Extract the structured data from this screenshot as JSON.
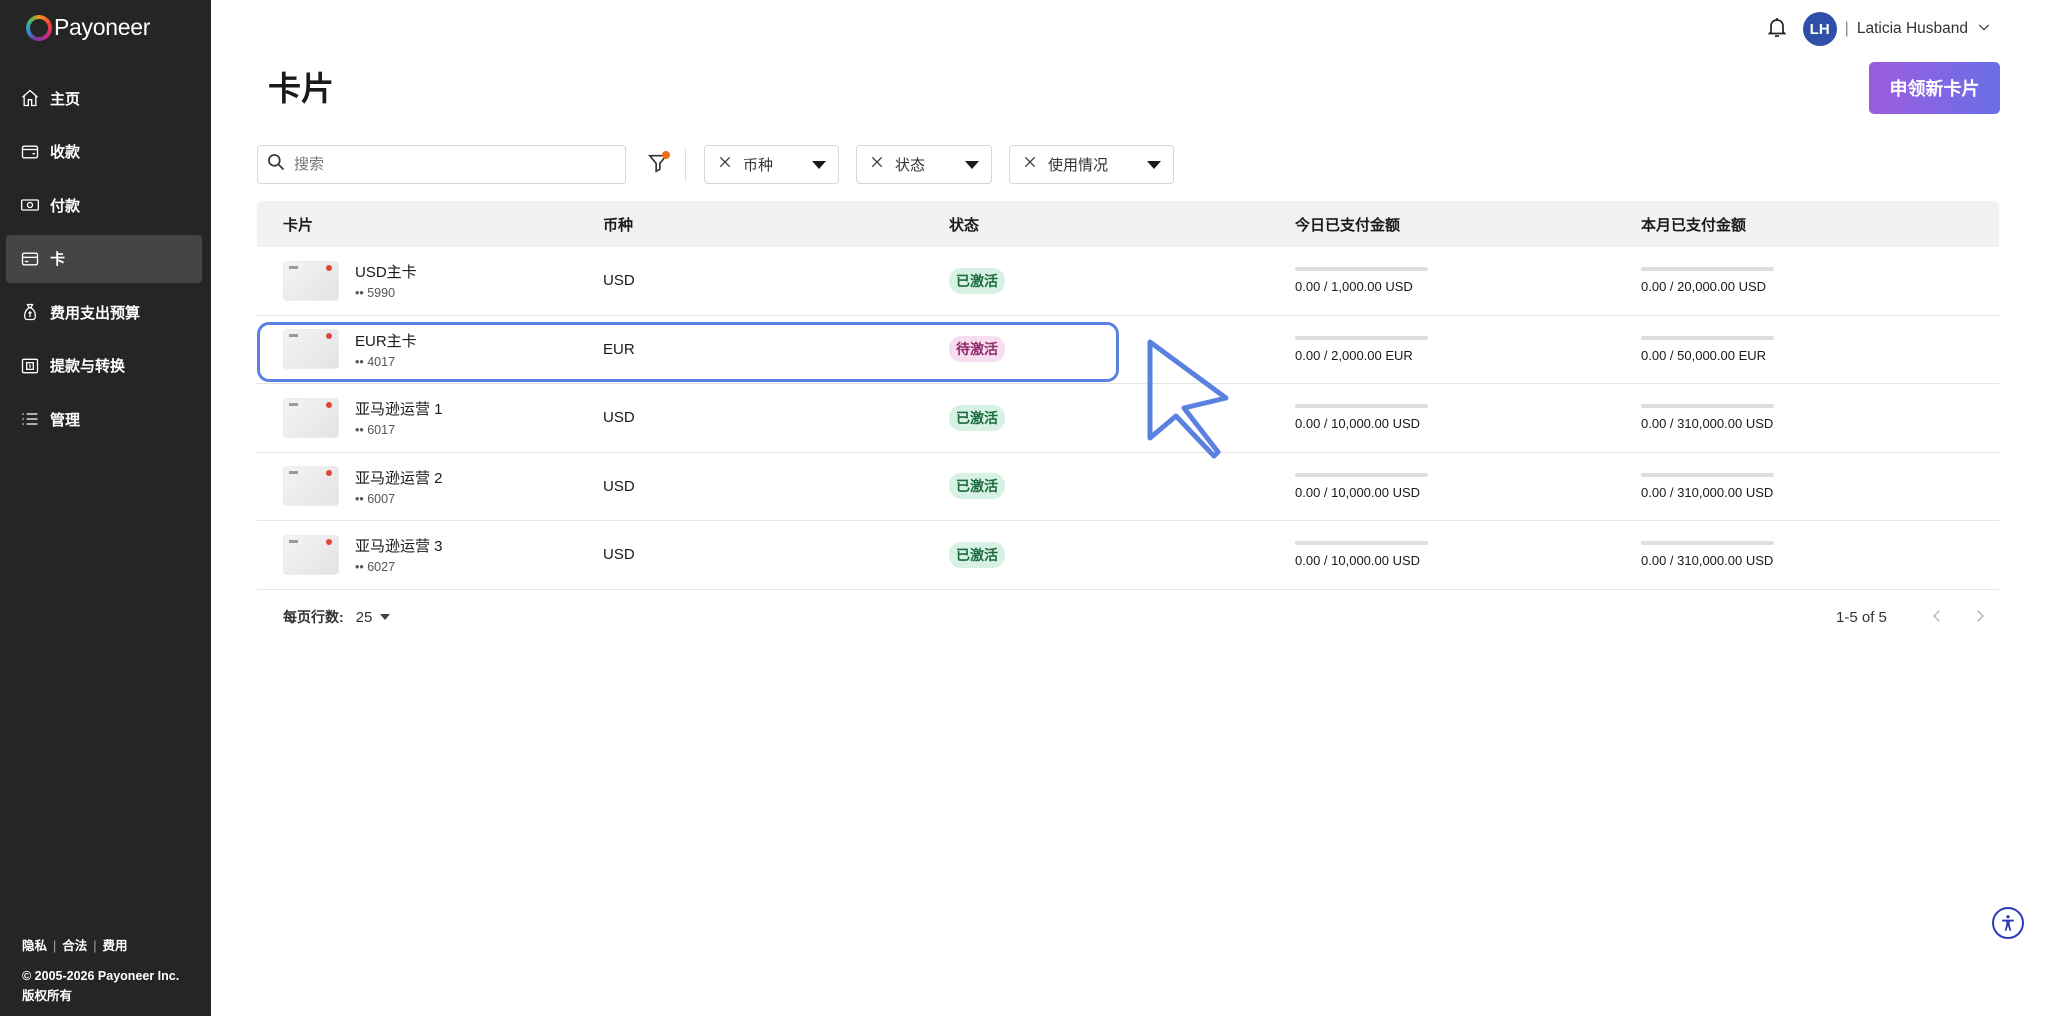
{
  "brand": {
    "name": "Payoneer"
  },
  "sidebar": {
    "items": [
      {
        "label": "主页",
        "icon": "home-icon"
      },
      {
        "label": "收款",
        "icon": "wallet-icon"
      },
      {
        "label": "付款",
        "icon": "cash-icon"
      },
      {
        "label": "卡",
        "icon": "card-icon",
        "active": true
      },
      {
        "label": "费用支出预算",
        "icon": "money-bag-icon"
      },
      {
        "label": "提款与转换",
        "icon": "withdraw-icon"
      },
      {
        "label": "管理",
        "icon": "list-icon"
      }
    ],
    "footer": {
      "links": [
        "隐私",
        "合法",
        "费用"
      ],
      "separator": "|",
      "copyright": "© 2005-2026 Payoneer Inc.",
      "rights": "版权所有"
    }
  },
  "header": {
    "user_initials": "LH",
    "user_separator": "|",
    "user_name": "Laticia Husband"
  },
  "page": {
    "title": "卡片",
    "new_card_button": "申领新卡片"
  },
  "filters": {
    "search_placeholder": "搜索",
    "chips": [
      {
        "label": "币种"
      },
      {
        "label": "状态"
      },
      {
        "label": "使用情况"
      }
    ]
  },
  "table": {
    "headers": {
      "card": "卡片",
      "currency": "币种",
      "status": "状态",
      "today_paid": "今日已支付金额",
      "month_paid": "本月已支付金额"
    },
    "rows": [
      {
        "name": "USD主卡",
        "number": "•• 5990",
        "currency": "USD",
        "status": "已激活",
        "status_type": "active",
        "today": "0.00 / 1,000.00 USD",
        "today_fraction": 0,
        "month": "0.00 / 20,000.00 USD",
        "month_fraction": 0
      },
      {
        "name": "EUR主卡",
        "number": "•• 4017",
        "currency": "EUR",
        "status": "待激活",
        "status_type": "pending",
        "today": "0.00 / 2,000.00 EUR",
        "today_fraction": 0,
        "month": "0.00 / 50,000.00 EUR",
        "month_fraction": 0
      },
      {
        "name": "亚马逊运营 1",
        "number": "•• 6017",
        "currency": "USD",
        "status": "已激活",
        "status_type": "active",
        "today": "0.00 / 10,000.00 USD",
        "today_fraction": 0,
        "month": "0.00 / 310,000.00 USD",
        "month_fraction": 0
      },
      {
        "name": "亚马逊运营 2",
        "number": "•• 6007",
        "currency": "USD",
        "status": "已激活",
        "status_type": "active",
        "today": "0.00 / 10,000.00 USD",
        "today_fraction": 0,
        "month": "0.00 / 310,000.00 USD",
        "month_fraction": 0
      },
      {
        "name": "亚马逊运营 3",
        "number": "•• 6027",
        "currency": "USD",
        "status": "已激活",
        "status_type": "active",
        "today": "0.00 / 10,000.00 USD",
        "today_fraction": 0,
        "month": "0.00 / 310,000.00 USD",
        "month_fraction": 0
      }
    ]
  },
  "pagination": {
    "rows_per_page_label": "每页行数:",
    "rows_per_page": "25",
    "range": "1-5 of 5"
  },
  "colors": {
    "sidebar_bg": "#252525",
    "accent_gradient_start": "#9d5ce0",
    "accent_gradient_end": "#6a6fe6",
    "annotation": "#5a80e0"
  }
}
